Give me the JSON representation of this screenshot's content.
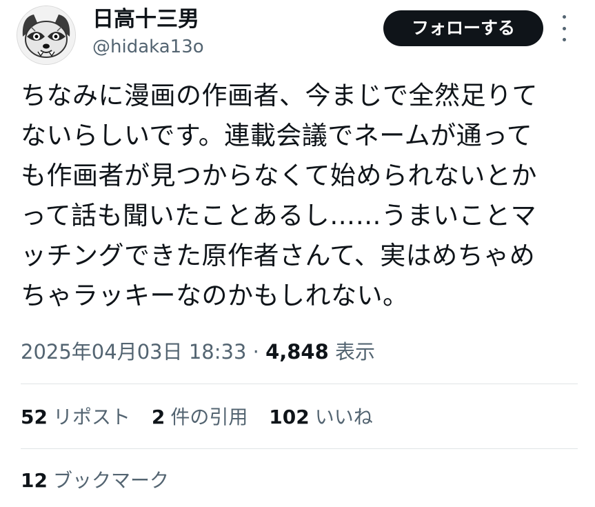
{
  "user": {
    "display_name": "日高十三男",
    "handle": "@hidaka13o",
    "avatar_icon": "raccoon-avatar-icon"
  },
  "header": {
    "follow_label": "フォローする",
    "more_icon": "more-options-icon"
  },
  "tweet": {
    "lines": [
      "ちなみに漫画の作画者、今まじで全然足りて",
      "ないらしいです。連載会議でネームが通って",
      "も作画者が見つからなくて始められないとか",
      "って話も聞いたことあるし……うまいことマ",
      "ッチングできた原作者さんて、実はめちゃめ",
      "ちゃラッキーなのかもしれない。"
    ]
  },
  "meta": {
    "timestamp": "2025年04月03日 18:33",
    "separator": "·",
    "views_count": "4,848",
    "views_label": "表示"
  },
  "stats": {
    "reposts": {
      "count": "52",
      "label": "リポスト"
    },
    "quotes": {
      "count": "2",
      "label": "件の引用"
    },
    "likes": {
      "count": "102",
      "label": "いいね"
    },
    "bookmarks": {
      "count": "12",
      "label": "ブックマーク"
    }
  },
  "colors": {
    "text_primary": "#0f1419",
    "text_secondary": "#536471",
    "button_bg": "#0f1419",
    "divider": "#dfe3e6"
  }
}
